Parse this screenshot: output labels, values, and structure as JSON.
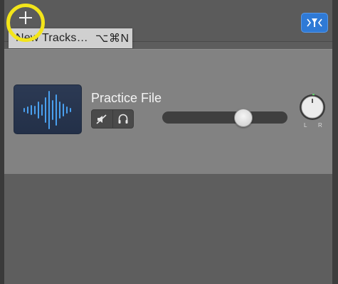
{
  "toolbar": {
    "add_label": "+",
    "tooltip": {
      "label": "New Tracks…",
      "shortcut": "⌥⌘N"
    },
    "filter_icon": "smart-controls-filter-icon"
  },
  "track": {
    "name": "Practice File",
    "icon": "audio-waveform-icon",
    "mute_icon": "mute-speaker-icon",
    "headphones_icon": "headphones-icon",
    "volume_level": 0.67,
    "pan": {
      "left_label": "L",
      "right_label": "R"
    }
  },
  "colors": {
    "accent": "#2f7ad6",
    "highlight": "#f3e51a",
    "waveform": "#4aa0ef"
  }
}
